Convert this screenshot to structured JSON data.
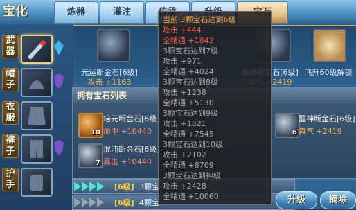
{
  "logo": "宝化",
  "tabs": [
    "炼器",
    "灌注",
    "传承",
    "升级",
    "宝石"
  ],
  "side_slots": [
    "武器",
    "帽子",
    "衣服",
    "裤子",
    "护手"
  ],
  "top_cards": [
    {
      "name": "元运断金石[6级]",
      "stat": "攻击 +1163"
    },
    {
      "name": "醒神断金石[6级]",
      "stat": "真气 +2419"
    },
    {
      "name": "飞升60级解锁"
    }
  ],
  "gem_panel": {
    "title": "拥有宝石列表",
    "gems": [
      {
        "name": "培元断金石[6级]",
        "stat": "命中 +10440",
        "level": "10"
      },
      {
        "name": "混沌断金石[6级]",
        "stat": "暴击 +10440",
        "level": "7"
      },
      {
        "name": "醒神断金石[6级]",
        "stat": "真气 +2419",
        "level": "6"
      }
    ]
  },
  "rows": [
    {
      "level": "[6级]",
      "text": "3颗宝"
    },
    {
      "level": "[6级]",
      "text": "4颗宝"
    }
  ],
  "buttons": {
    "upgrade": "升级",
    "remove": "摘除"
  },
  "tooltip": {
    "lines": [
      {
        "text": "当前 3颗宝石达到6级",
        "color": "orange"
      },
      {
        "text": "攻击 +444",
        "color": "red"
      },
      {
        "text": "全精通 +1842",
        "color": "red"
      },
      {
        "text": "3颗宝石达到7级",
        "color": "grey"
      },
      {
        "text": "攻击 +971",
        "color": "grey"
      },
      {
        "text": "全精通 +4024",
        "color": "grey"
      },
      {
        "text": "3颗宝石达到8级",
        "color": "grey"
      },
      {
        "text": "攻击 +1238",
        "color": "grey"
      },
      {
        "text": "全精通 +5130",
        "color": "grey"
      },
      {
        "text": "3颗宝石达到9级",
        "color": "grey"
      },
      {
        "text": "攻击 +1821",
        "color": "grey"
      },
      {
        "text": "全精通 +7545",
        "color": "grey"
      },
      {
        "text": "3颗宝石达到10级",
        "color": "grey"
      },
      {
        "text": "攻击 +2102",
        "color": "grey"
      },
      {
        "text": "全精通 +8709",
        "color": "grey"
      },
      {
        "text": "3颗宝石达到神级",
        "color": "grey"
      },
      {
        "text": "攻击 +2428",
        "color": "grey"
      },
      {
        "text": "全精通 +10060",
        "color": "grey"
      }
    ]
  },
  "colors": {
    "orange": "#ff9a2e",
    "red": "#ff5a3c",
    "grey": "#a7a7a7"
  }
}
